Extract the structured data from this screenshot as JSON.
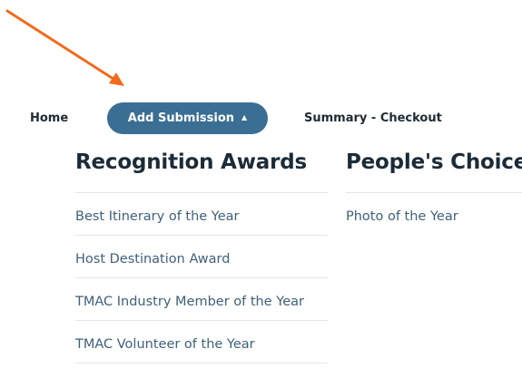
{
  "nav": {
    "home_label": "Home",
    "add_submission_label": "Add Submission",
    "summary_label": "Summary - Checkout"
  },
  "columns": {
    "left": {
      "title": "Recognition Awards",
      "items": [
        "Best Itinerary of the Year",
        "Host Destination Award",
        "TMAC Industry Member of the Year",
        "TMAC Volunteer of the Year"
      ]
    },
    "right": {
      "title": "People's Choice",
      "items": [
        "Photo of the Year"
      ]
    }
  },
  "colors": {
    "accent": "#3b6e93",
    "arrow": "#f26a1b",
    "link_text": "#3e607a",
    "heading_text": "#1c2b38"
  },
  "icons": {
    "annotation": "arrow-icon",
    "dropdown": "caret-up-icon"
  }
}
